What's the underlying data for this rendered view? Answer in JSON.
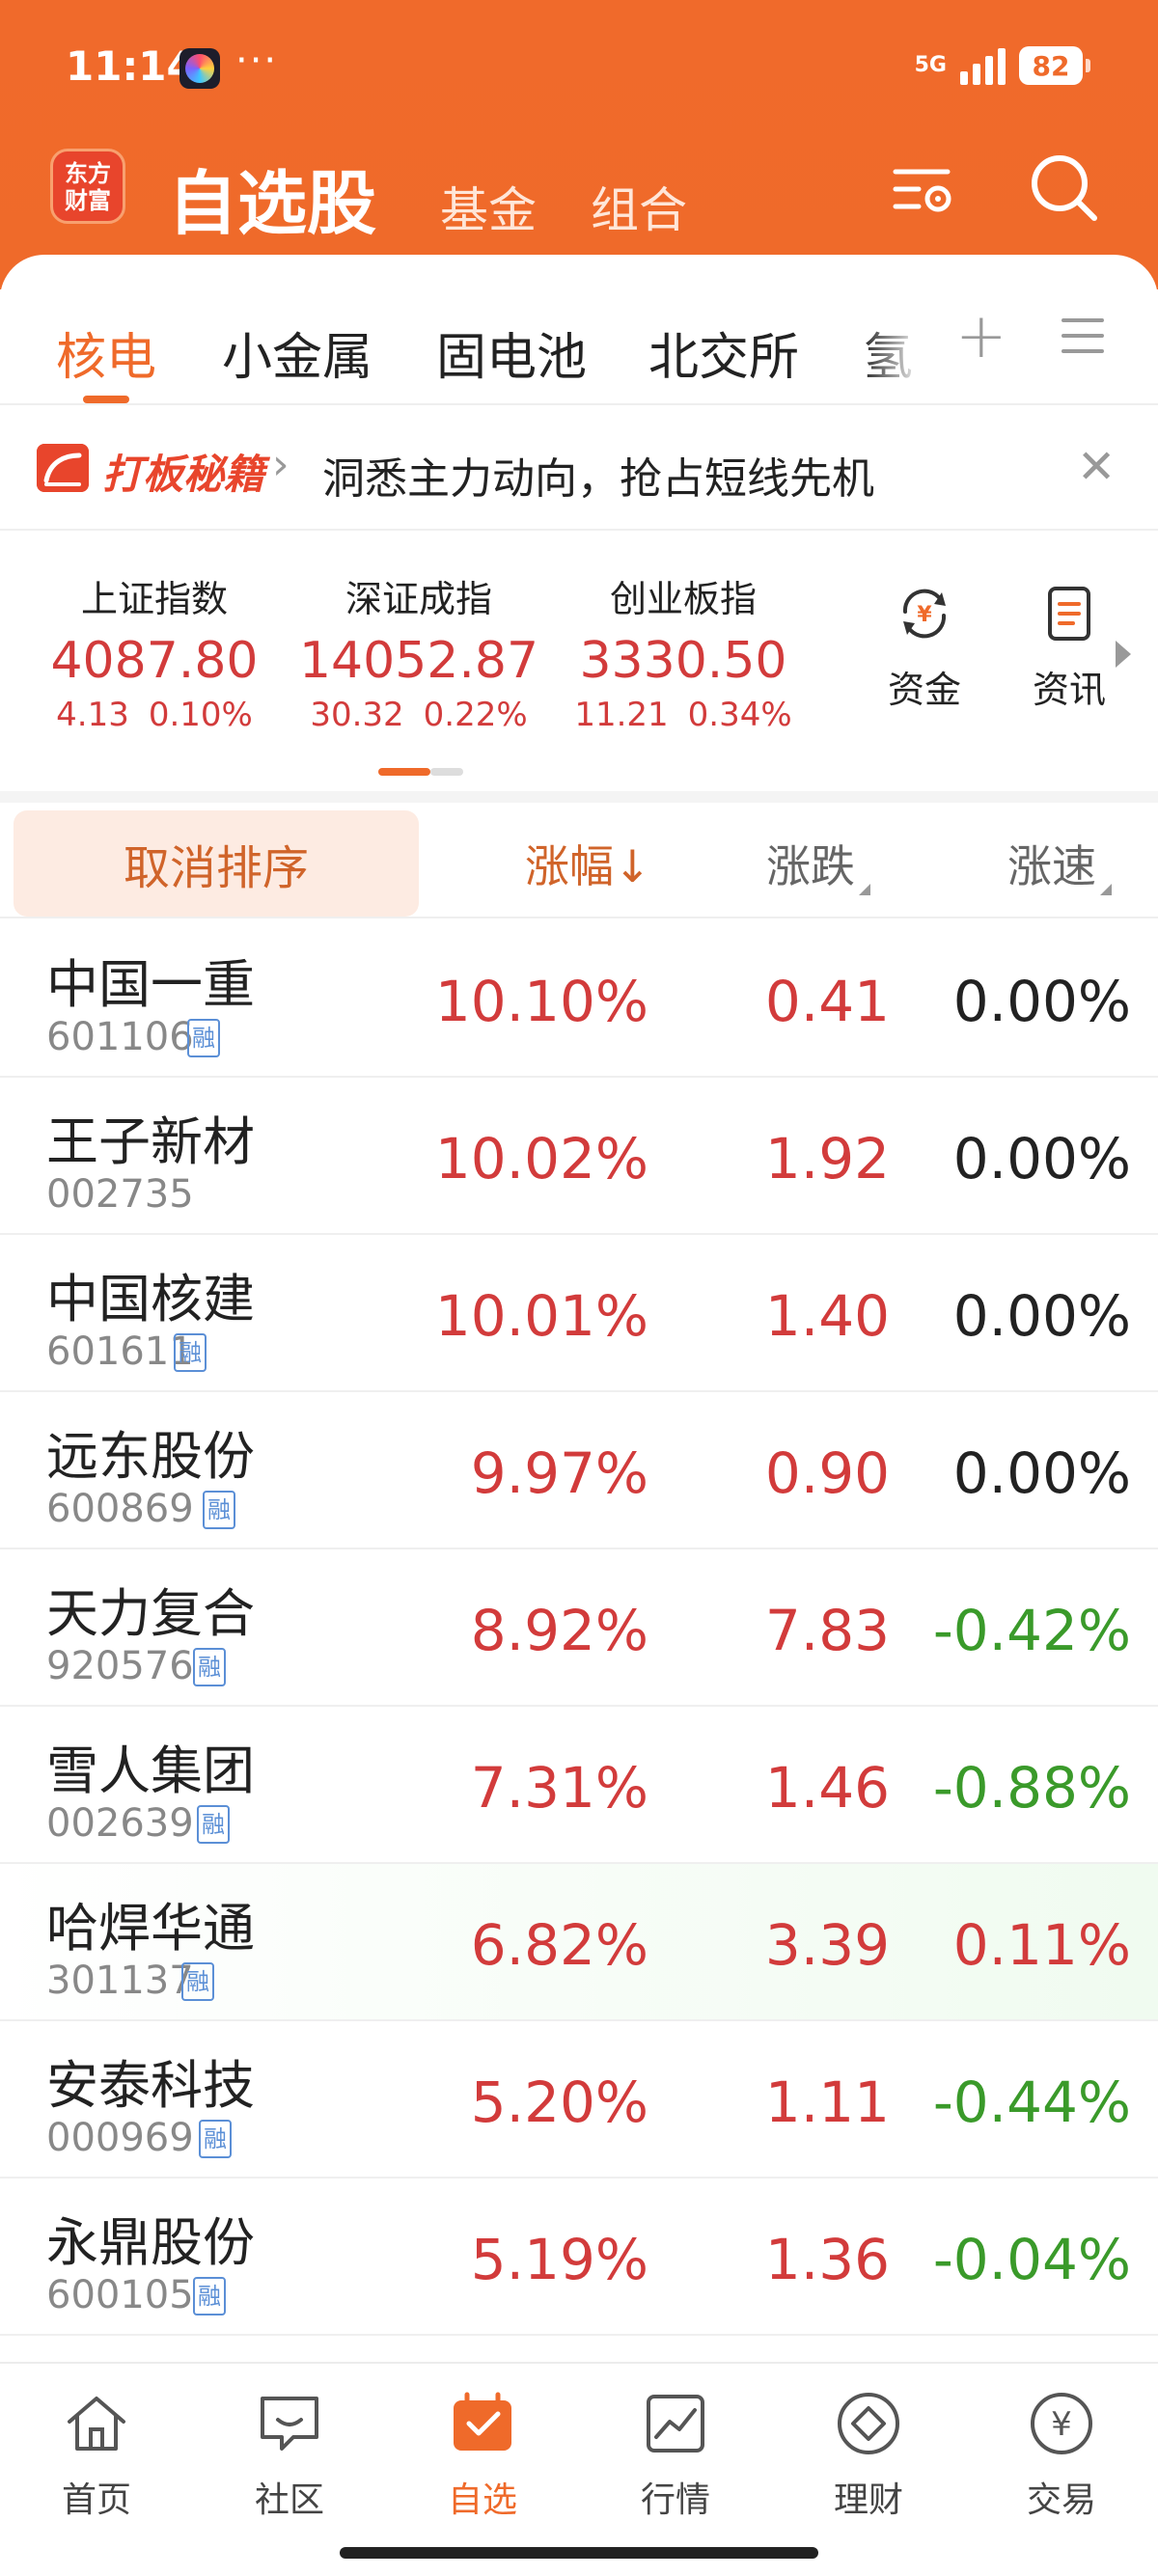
{
  "status": {
    "time": "11:14",
    "dots": "···",
    "network": "5G",
    "battery": "82"
  },
  "header": {
    "logo_line1": "东方",
    "logo_line2": "财富",
    "tab_main": "自选股",
    "tab_fund": "基金",
    "tab_group": "组合"
  },
  "categories": [
    "核电",
    "小金属",
    "固电池",
    "北交所",
    "氢"
  ],
  "promo": {
    "brand": "打板秘籍",
    "text": "洞悉主力动向，抢占短线先机"
  },
  "indices": [
    {
      "name": "上证指数",
      "value": "4087.80",
      "change": "4.13",
      "pct": "0.10%"
    },
    {
      "name": "深证成指",
      "value": "14052.87",
      "change": "30.32",
      "pct": "0.22%"
    },
    {
      "name": "创业板指",
      "value": "3330.50",
      "change": "11.21",
      "pct": "0.34%"
    }
  ],
  "quick": {
    "funds": "资金",
    "news": "资讯"
  },
  "columns": {
    "cancel_sort": "取消排序",
    "pct": "涨幅",
    "pct_arrow": "↓",
    "change": "涨跌",
    "speed": "涨速"
  },
  "rong_label": "融",
  "colors": {
    "accent": "#ef6a2a",
    "up": "#d23b3b",
    "down": "#3a9a2a"
  },
  "stocks": [
    {
      "name": "中国一重",
      "code": "601106",
      "rong": true,
      "pct": "10.10%",
      "change": "0.41",
      "speed": "0.00%"
    },
    {
      "name": "王子新材",
      "code": "002735",
      "rong": false,
      "pct": "10.02%",
      "change": "1.92",
      "speed": "0.00%"
    },
    {
      "name": "中国核建",
      "code": "601611",
      "rong": true,
      "pct": "10.01%",
      "change": "1.40",
      "speed": "0.00%"
    },
    {
      "name": "远东股份",
      "code": "600869",
      "rong": true,
      "pct": "9.97%",
      "change": "0.90",
      "speed": "0.00%"
    },
    {
      "name": "天力复合",
      "code": "920576",
      "rong": true,
      "pct": "8.92%",
      "change": "7.83",
      "speed": "-0.42%"
    },
    {
      "name": "雪人集团",
      "code": "002639",
      "rong": true,
      "pct": "7.31%",
      "change": "1.46",
      "speed": "-0.88%"
    },
    {
      "name": "哈焊华通",
      "code": "301137",
      "rong": true,
      "pct": "6.82%",
      "change": "3.39",
      "speed": "0.11%"
    },
    {
      "name": "安泰科技",
      "code": "000969",
      "rong": true,
      "pct": "5.20%",
      "change": "1.11",
      "speed": "-0.44%"
    },
    {
      "name": "永鼎股份",
      "code": "600105",
      "rong": true,
      "pct": "5.19%",
      "change": "1.36",
      "speed": "-0.04%"
    }
  ],
  "nav": [
    {
      "label": "首页",
      "icon": "home-icon"
    },
    {
      "label": "社区",
      "icon": "community-icon"
    },
    {
      "label": "自选",
      "icon": "watchlist-icon"
    },
    {
      "label": "行情",
      "icon": "market-icon"
    },
    {
      "label": "理财",
      "icon": "wealth-icon"
    },
    {
      "label": "交易",
      "icon": "trade-icon"
    }
  ]
}
